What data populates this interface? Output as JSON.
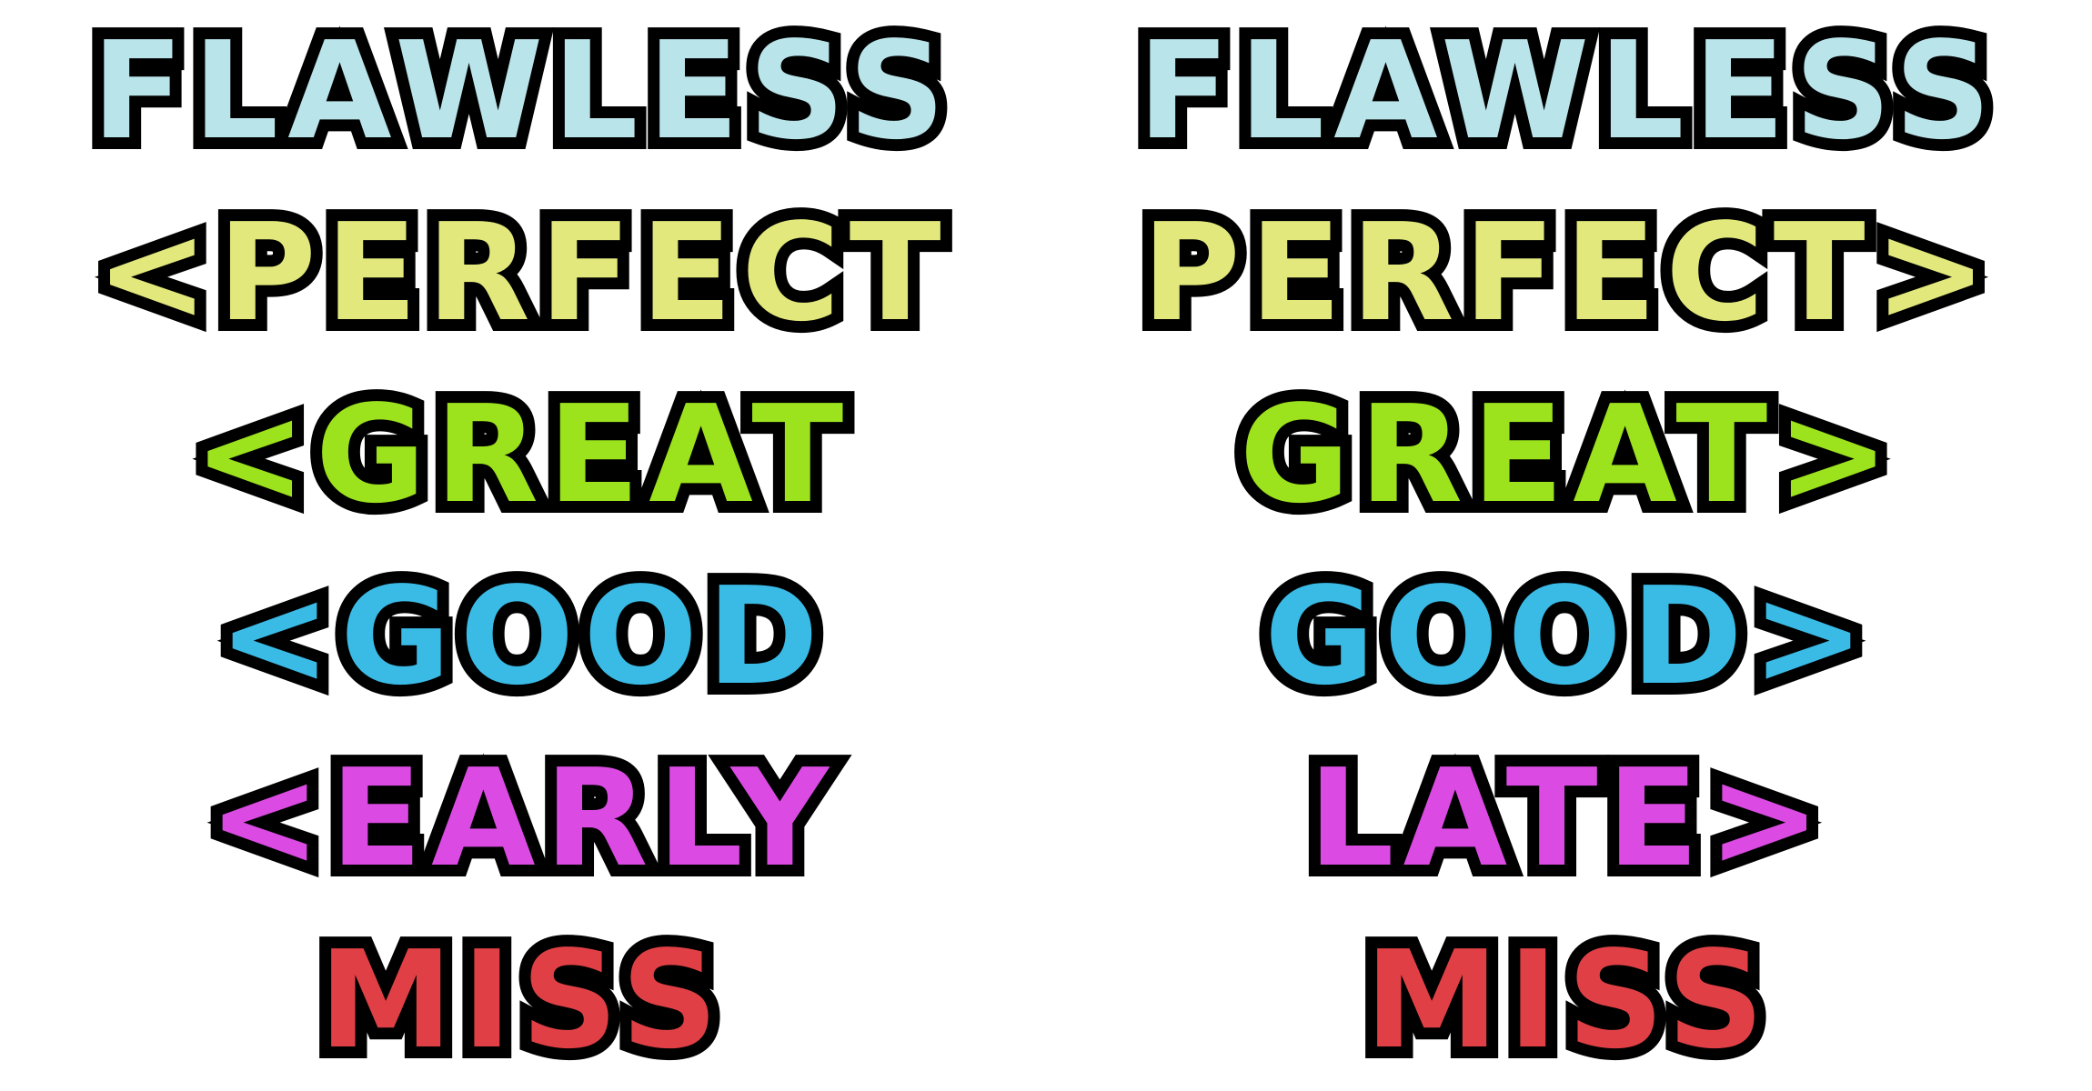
{
  "colors": {
    "flawless": "#b9e4ea",
    "perfect": "#e2e87c",
    "great": "#9ce21d",
    "good": "#3abbe6",
    "early_late": "#db4be3",
    "miss": "#e04045",
    "outline": "#000000",
    "background": "#ffffff"
  },
  "early_column": {
    "flawless": "FLAWLESS",
    "perfect": "<PERFECT",
    "great": "<GREAT",
    "good": "<GOOD",
    "timing": "<EARLY",
    "miss": "MISS"
  },
  "late_column": {
    "flawless": "FLAWLESS",
    "perfect": "PERFECT>",
    "great": "GREAT>",
    "good": "GOOD>",
    "timing": "LATE>",
    "miss": "MISS"
  }
}
